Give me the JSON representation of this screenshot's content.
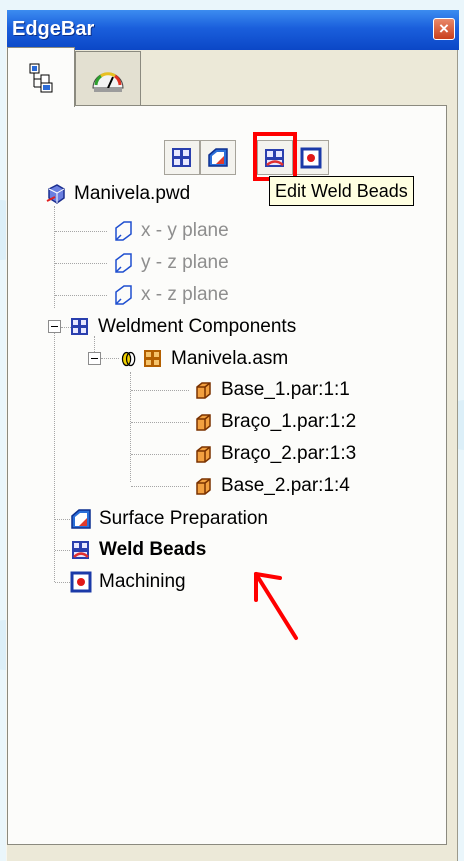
{
  "window": {
    "title": "EdgeBar",
    "close_glyph": "×"
  },
  "tabs": [
    {
      "icon": "feature-pathfinder-icon",
      "active": true
    },
    {
      "icon": "gauge-icon",
      "active": false
    }
  ],
  "toolbar": {
    "buttons": [
      {
        "icon": "weldment-components-icon"
      },
      {
        "icon": "surface-preparation-icon"
      },
      {
        "icon": "edit-weld-beads-icon",
        "highlighted": true
      },
      {
        "icon": "machining-icon"
      }
    ],
    "tooltip": "Edit Weld Beads"
  },
  "tree": {
    "root": "Manivela.pwd",
    "planes": [
      "x - y plane",
      "y - z plane",
      "x - z plane"
    ],
    "weldment_components": "Weldment Components",
    "assembly": "Manivela.asm",
    "parts": [
      "Base_1.par:1:1",
      "Braço_1.par:1:2",
      "Braço_2.par:1:3",
      "Base_2.par:1:4"
    ],
    "surface_preparation": "Surface Preparation",
    "weld_beads": "Weld Beads",
    "machining": "Machining"
  },
  "colors": {
    "title_bar": "#0b47c7",
    "annotation_red": "#ff0000",
    "tooltip_bg": "#ffffe1"
  }
}
